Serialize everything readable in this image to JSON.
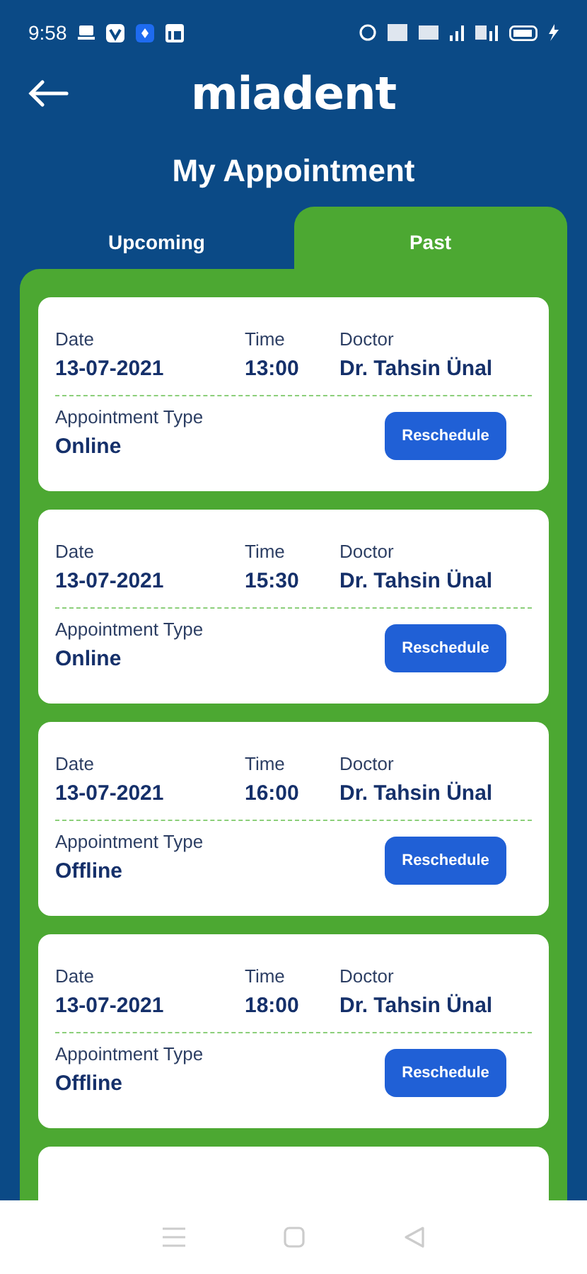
{
  "status_bar": {
    "time": "9:58"
  },
  "header": {
    "logo": "miadent",
    "title": "My Appointment"
  },
  "tabs": [
    {
      "label": "Upcoming",
      "selected": false
    },
    {
      "label": "Past",
      "selected": true
    }
  ],
  "appointments": [
    {
      "date_label": "Date",
      "date": "13-07-2021",
      "time_label": "Time",
      "time": "13:00",
      "doctor_label": "Doctor",
      "doctor": "Dr. Tahsin Ünal",
      "type_label": "Appointment Type",
      "type": "Online",
      "button": "Reschedule"
    },
    {
      "date_label": "Date",
      "date": "13-07-2021",
      "time_label": "Time",
      "time": "15:30",
      "doctor_label": "Doctor",
      "doctor": "Dr. Tahsin Ünal",
      "type_label": "Appointment Type",
      "type": "Online",
      "button": "Reschedule"
    },
    {
      "date_label": "Date",
      "date": "13-07-2021",
      "time_label": "Time",
      "time": "16:00",
      "doctor_label": "Doctor",
      "doctor": "Dr. Tahsin Ünal",
      "type_label": "Appointment Type",
      "type": "Offline",
      "button": "Reschedule"
    },
    {
      "date_label": "Date",
      "date": "13-07-2021",
      "time_label": "Time",
      "time": "18:00",
      "doctor_label": "Doctor",
      "doctor": "Dr. Tahsin Ünal",
      "type_label": "Appointment Type",
      "type": "Offline",
      "button": "Reschedule"
    }
  ]
}
